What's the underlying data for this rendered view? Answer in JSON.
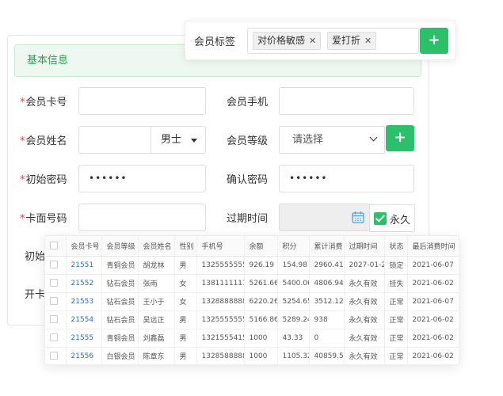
{
  "form": {
    "section_title": "基本信息",
    "required_mark": "*",
    "labels": {
      "card_no": "会员卡号",
      "phone": "会员手机",
      "name": "会员姓名",
      "level": "会员等级",
      "init_password": "初始密码",
      "confirm_password": "确认密码",
      "face_no": "卡面号码",
      "expire_time": "过期时间",
      "init_partial": "初始",
      "open_partial": "开卡"
    },
    "values": {
      "card_no": "",
      "phone": "",
      "name": "",
      "gender": "男士",
      "level_placeholder": "请选择",
      "init_password": "••••••",
      "confirm_password": "••••••",
      "face_no": "",
      "permanent": "永久"
    },
    "plus_label": "+"
  },
  "tags": {
    "label": "会员标签",
    "items": [
      {
        "text": "对价格敏感",
        "remove": "✕"
      },
      {
        "text": "爱打折",
        "remove": "✕"
      }
    ],
    "plus_label": "+"
  },
  "table": {
    "headers": [
      "",
      "会员卡号",
      "会员等级",
      "会员姓名",
      "性别",
      "手机号",
      "余额",
      "积分",
      "累计消费",
      "过期时间",
      "状态",
      "最后消费时间"
    ],
    "rows": [
      [
        "21551",
        "青铜会员",
        "胡龙林",
        "男",
        "13255555552",
        "926.19",
        "154.98",
        "2960.41",
        "2027-01-29",
        "锁定",
        "2021-06-07"
      ],
      [
        "21552",
        "钻石会员",
        "张雨",
        "女",
        "13811111111",
        "5261.66",
        "5400.06",
        "4806.94",
        "永久有效",
        "挂失",
        "2021-06-02"
      ],
      [
        "21553",
        "钻石会员",
        "王小于",
        "女",
        "13288888888",
        "6220.26",
        "5254.65",
        "3512.12",
        "永久有效",
        "正常",
        "2021-06-07"
      ],
      [
        "21554",
        "钻石会员",
        "吴远正",
        "男",
        "13255555555",
        "5166.86",
        "5289.24",
        "938",
        "永久有效",
        "正常",
        "2021-06-02"
      ],
      [
        "21555",
        "青铜会员",
        "刘鑫磊",
        "男",
        "13215554154",
        "1000",
        "43.33",
        "0",
        "永久有效",
        "正常",
        "2021-06-02"
      ],
      [
        "21556",
        "白银会员",
        "陈章东",
        "男",
        "13285888885",
        "1000",
        "1105.32",
        "40859.5",
        "永久有效",
        "正常",
        "2021-06-02"
      ]
    ]
  },
  "colors": {
    "accent": "#2dc06b",
    "section_bg": "#edf8f0",
    "link": "#2f6db5",
    "required": "#e64340"
  }
}
